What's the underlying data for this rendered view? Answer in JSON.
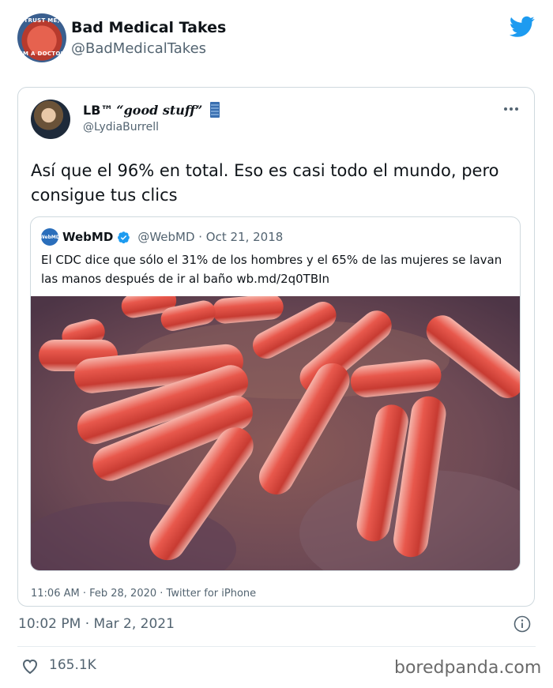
{
  "outer_tweet": {
    "avatar_caption_top": "TRUST ME,",
    "avatar_caption_bottom": "I'M A DOCTOR",
    "display_name": "Bad Medical Takes",
    "handle": "@BadMedicalTakes",
    "timestamp": "10:02 PM · Mar 2, 2021",
    "likes": "165.1K"
  },
  "embedded_tweet": {
    "name_prefix": "LB™",
    "name_quote": "“good stuff”",
    "handle": "@LydiaBurrell",
    "text": "Así que el 96% en total. Eso es casi todo el mundo, pero consigue tus clics",
    "footer": "11:06 AM · Feb 28, 2020 · Twitter for iPhone"
  },
  "quoted_tweet": {
    "logo_text": "WebMD",
    "name": "WebMD",
    "handle_and_date": "@WebMD · Oct 21, 2018",
    "text": "El CDC dice que sólo el 31% de los hombres y el 65% de las mujeres se lavan las manos después de ir al baño wb.md/2q0TBIn"
  },
  "watermark": "boredpanda.com",
  "icons": {
    "brand": "twitter-bird-icon",
    "more": "more-options-icon",
    "verified": "verified-badge-icon",
    "info": "info-icon",
    "like": "heart-icon",
    "badge": "book-icon"
  },
  "colors": {
    "twitter_blue": "#1d9bf0",
    "text_primary": "#0f1419",
    "text_secondary": "#536471",
    "border": "#cfd9de"
  }
}
